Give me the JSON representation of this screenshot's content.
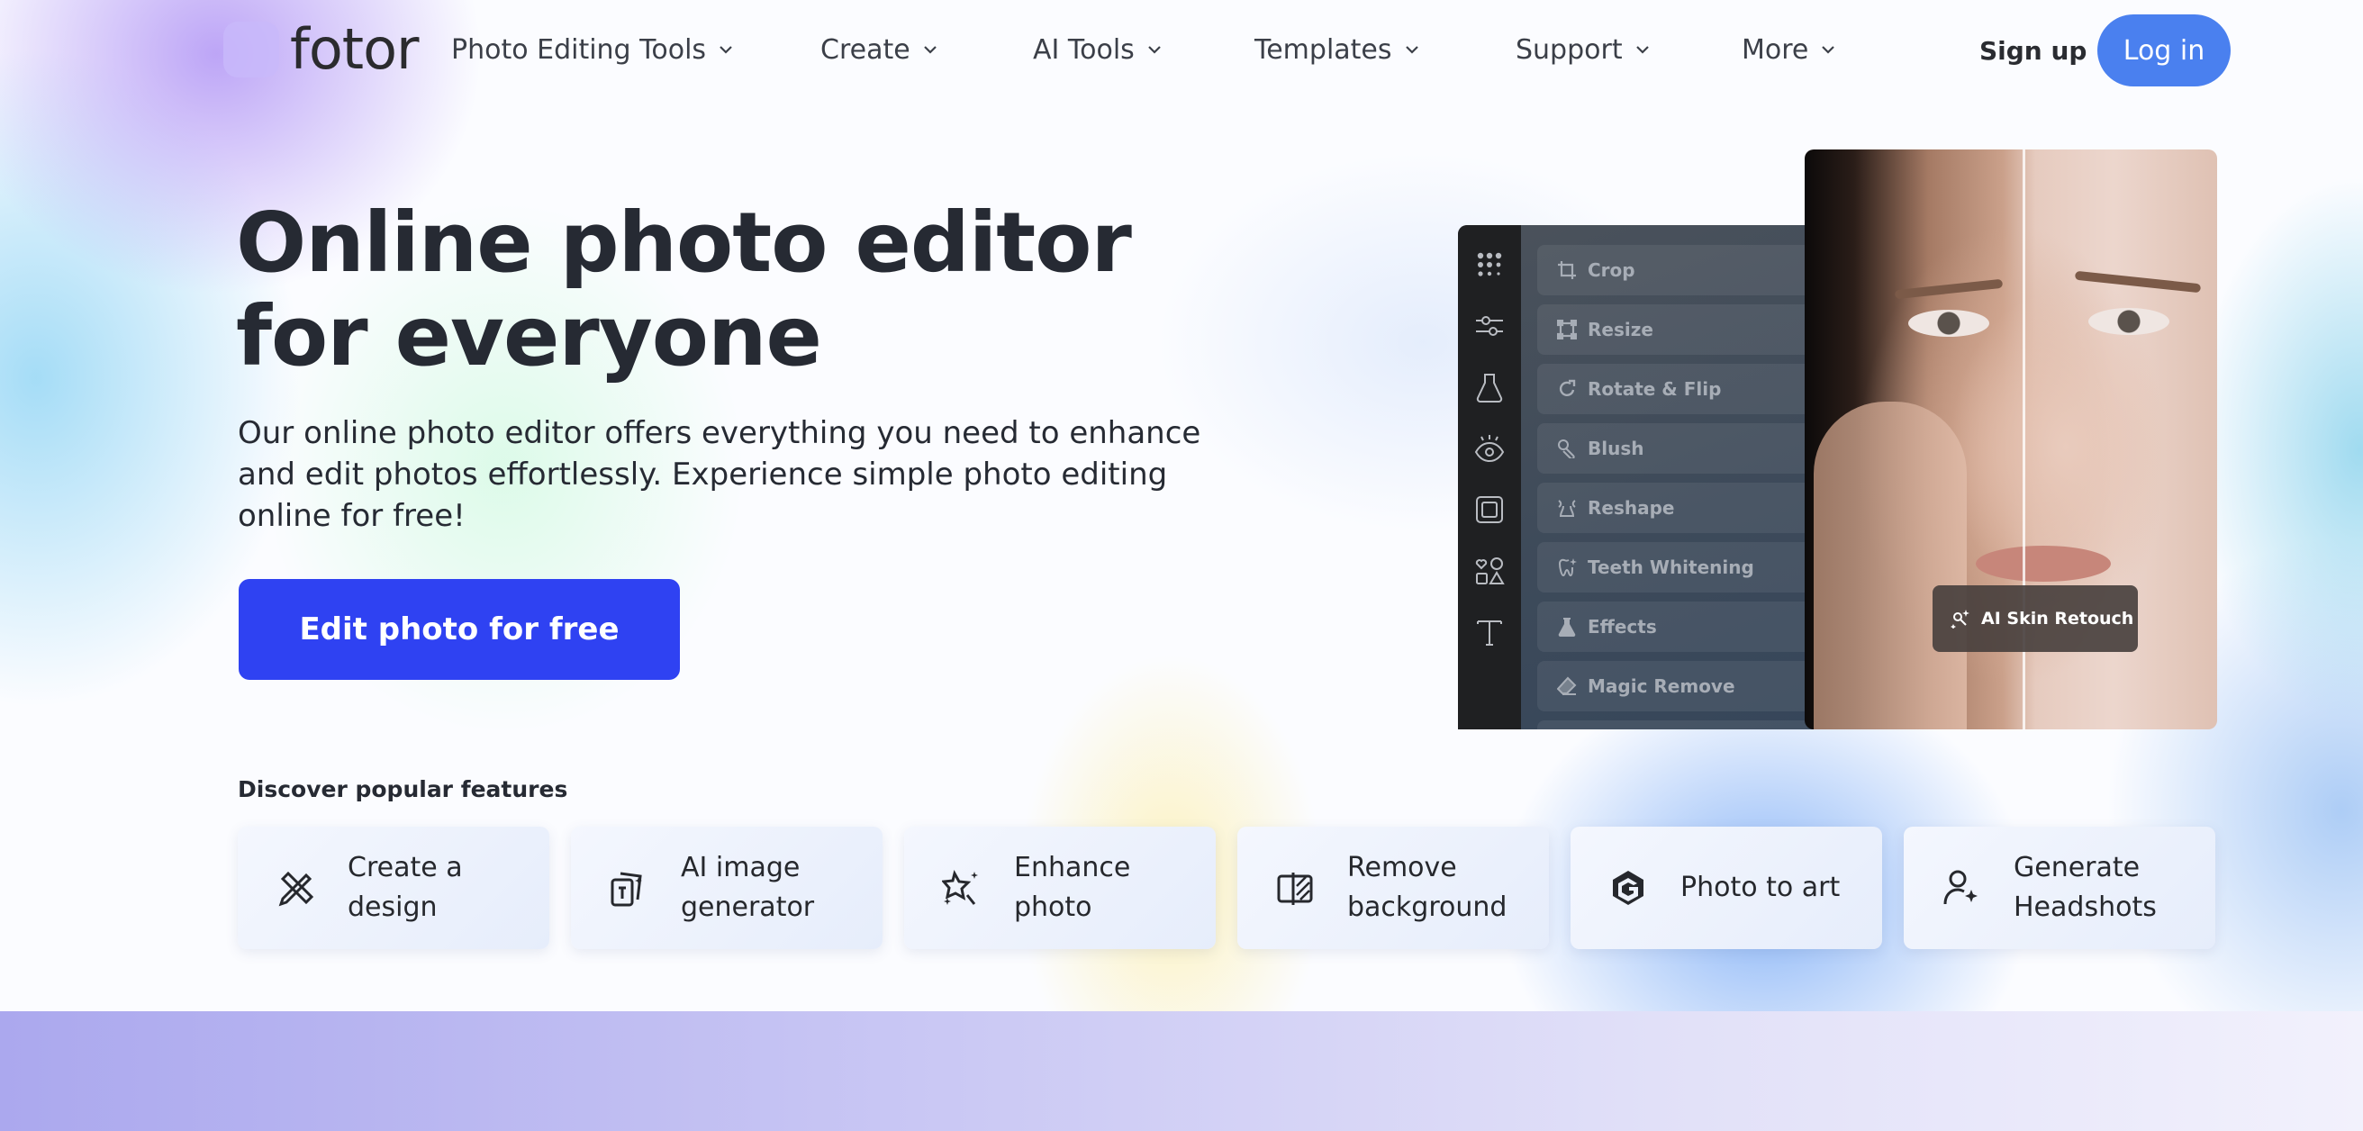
{
  "brand": {
    "name": "fotor",
    "logo_icon": "color-wheel-logo"
  },
  "nav": {
    "items": [
      {
        "label": "Photo Editing Tools",
        "icon": "chevron-down-icon"
      },
      {
        "label": "Create",
        "icon": "chevron-down-icon"
      },
      {
        "label": "AI Tools",
        "icon": "chevron-down-icon"
      },
      {
        "label": "Templates",
        "icon": "chevron-down-icon"
      },
      {
        "label": "Support",
        "icon": "chevron-down-icon"
      },
      {
        "label": "More",
        "icon": "chevron-down-icon"
      }
    ],
    "signup_label": "Sign up",
    "login_label": "Log in"
  },
  "hero": {
    "headline": "Online photo editor for everyone",
    "subtext": "Our online photo editor offers everything you need to enhance and edit photos effortlessly. Experience simple photo editing online for free!",
    "cta_label": "Edit photo for free"
  },
  "editor_mockup": {
    "rail_icons": [
      "grid-dots-icon",
      "sliders-icon",
      "flask-icon",
      "eye-icon",
      "frame-icon",
      "shapes-icon",
      "text-icon"
    ],
    "tools": [
      {
        "label": "Crop",
        "icon": "crop-icon"
      },
      {
        "label": "Resize",
        "icon": "resize-icon"
      },
      {
        "label": "Rotate & Flip",
        "icon": "rotate-icon"
      },
      {
        "label": "Blush",
        "icon": "blush-brush-icon"
      },
      {
        "label": "Reshape",
        "icon": "reshape-icon"
      },
      {
        "label": "Teeth Whitening",
        "icon": "tooth-sparkle-icon"
      },
      {
        "label": "Effects",
        "icon": "flask-filled-icon"
      },
      {
        "label": "Magic Remove",
        "icon": "eraser-icon"
      }
    ],
    "badge_label": "AI Skin Retouch",
    "badge_icon": "magic-brush-icon"
  },
  "features": {
    "title": "Discover popular features",
    "cards": [
      {
        "label": "Create a design",
        "icon": "pencil-ruler-icon"
      },
      {
        "label": "AI image generator",
        "icon": "ai-image-cards-icon"
      },
      {
        "label": "Enhance photo",
        "icon": "magic-star-icon"
      },
      {
        "label": "Remove background",
        "icon": "remove-bg-icon"
      },
      {
        "label": "Photo to art",
        "icon": "hexagon-g-icon"
      },
      {
        "label": "Generate Headshots",
        "icon": "user-sparkle-icon"
      }
    ]
  },
  "colors": {
    "primary_cta": "#2f42f2",
    "login_button": "#4a80ef",
    "text_dark": "#262a33"
  }
}
